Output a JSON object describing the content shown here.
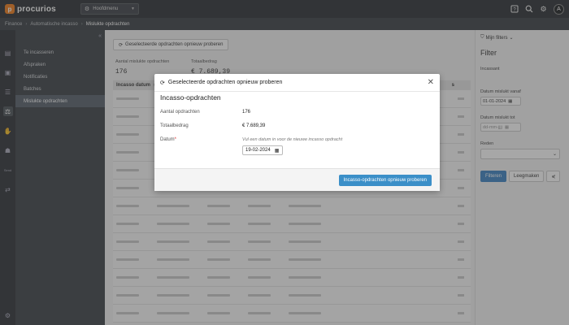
{
  "app": {
    "logo_text": "procurios",
    "logo_mark": "p"
  },
  "topbar": {
    "menu_label": "Hoofdmenu",
    "avatar": "A"
  },
  "breadcrumb": {
    "items": [
      "Finance",
      "Automatische incasso",
      "Mislukte opdrachten"
    ]
  },
  "subnav": {
    "items": [
      {
        "label": "Te incasseren"
      },
      {
        "label": "Afspraken"
      },
      {
        "label": "Notificaties"
      },
      {
        "label": "Batches"
      },
      {
        "label": "Mislukte opdrachten",
        "active": true
      }
    ]
  },
  "main": {
    "retry_button": "Geselecteerde opdrachten opnieuw proberen",
    "count_label": "Aantal mislukte opdrachten",
    "count_value": "176",
    "total_label": "Totaalbedrag",
    "total_value": "€ 7.689,39",
    "table_header_first": "Incasso datum",
    "table_header_trailing": "s"
  },
  "filters": {
    "my_filters": "Mijn filters",
    "title": "Filter",
    "incassant_label": "Incassant",
    "from_label": "Datum mislukt vanaf",
    "from_value": "01-01-2024",
    "to_label": "Datum mislukt tot",
    "to_placeholder": "dd-mm-jjjj",
    "reason_label": "Reden",
    "filter_button": "Filteren",
    "clear_button": "Leegmaken"
  },
  "modal": {
    "header": "Geselecteerde opdrachten opnieuw proberen",
    "title": "Incasso-opdrachten",
    "count_label": "Aantal opdrachten",
    "count_value": "176",
    "total_label": "Totaalbedrag",
    "total_value": "€ 7.689,39",
    "date_label": "Datum",
    "required_mark": "*",
    "date_hint": "Vul een datum in voor de nieuwe incasso opdracht",
    "date_value": "19-02-2024",
    "submit_button": "Incasso-opdrachten opnieuw proberen"
  }
}
